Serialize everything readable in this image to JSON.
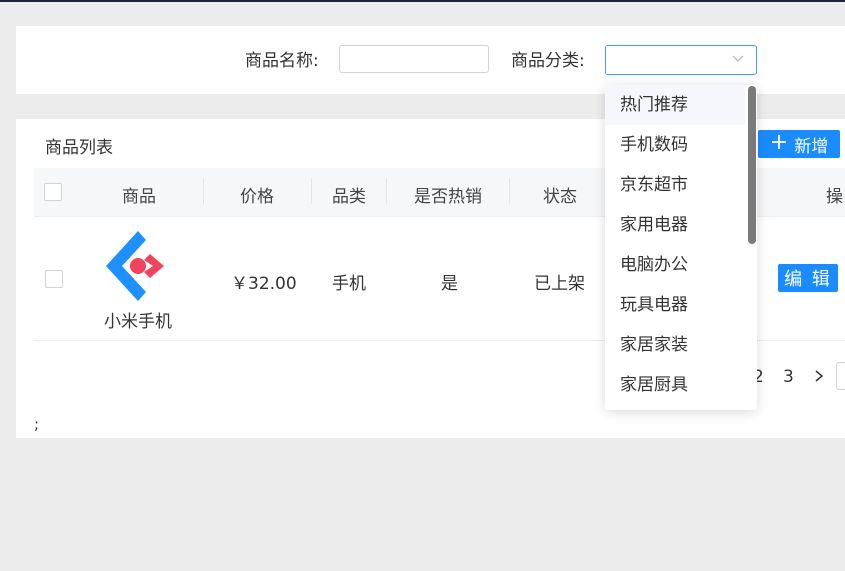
{
  "search": {
    "name_label": "商品名称:",
    "name_value": "",
    "category_label": "商品分类:",
    "category_value": ""
  },
  "list": {
    "title": "商品列表",
    "add_label": "新增",
    "columns": [
      "商品",
      "价格",
      "品类",
      "是否热销",
      "状态",
      "操"
    ],
    "rows": [
      {
        "product_name": "小米手机",
        "price": "￥32.00",
        "category": "手机",
        "hot": "是",
        "status": "已上架",
        "edit_label": "编 辑"
      }
    ]
  },
  "pagination": {
    "pages": [
      "2",
      "3"
    ],
    "next_icon": "chevron-right-icon"
  },
  "footer_text": ";",
  "dropdown": {
    "options": [
      "热门推荐",
      "手机数码",
      "京东超市",
      "家用电器",
      "电脑办公",
      "玩具电器",
      "家居家装",
      "家居厨具"
    ],
    "hovered_index": 0
  },
  "colors": {
    "primary": "#1a8cff",
    "topbar": "#1b2738",
    "background": "#ececec"
  }
}
